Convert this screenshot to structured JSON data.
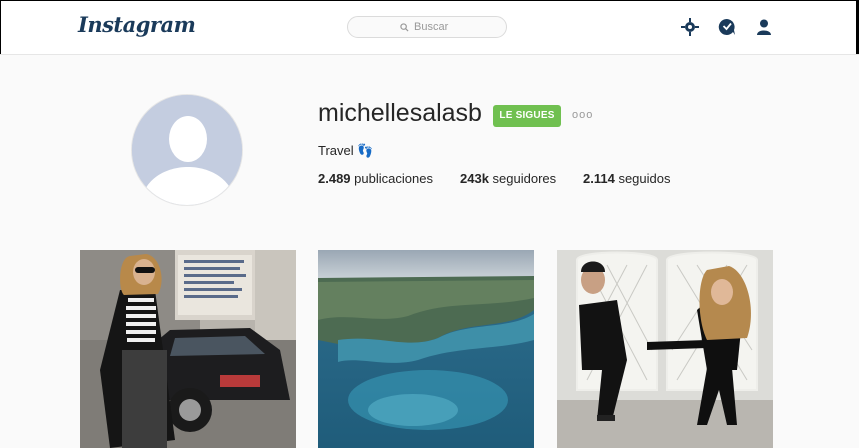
{
  "app": {
    "logo": "Instagram"
  },
  "header": {
    "search": {
      "placeholder": "Buscar"
    },
    "icons": [
      "explore-icon",
      "activity-icon",
      "profile-icon"
    ]
  },
  "profile": {
    "username": "michellesalasb",
    "follow_label": "LE SIGUES",
    "more_label": "ooo",
    "bio": "Travel 👣",
    "stats": [
      {
        "value": "2.489",
        "label": "publicaciones"
      },
      {
        "value": "243k",
        "label": "seguidores"
      },
      {
        "value": "2.114",
        "label": "seguidos"
      }
    ]
  },
  "posts": [
    {
      "name": "post-street-fashion"
    },
    {
      "name": "post-aerial-coast"
    },
    {
      "name": "post-couple-chairs"
    }
  ],
  "colors": {
    "brand": "#1a3a5a",
    "follow_green": "#70c050",
    "bg": "#fafafa"
  }
}
